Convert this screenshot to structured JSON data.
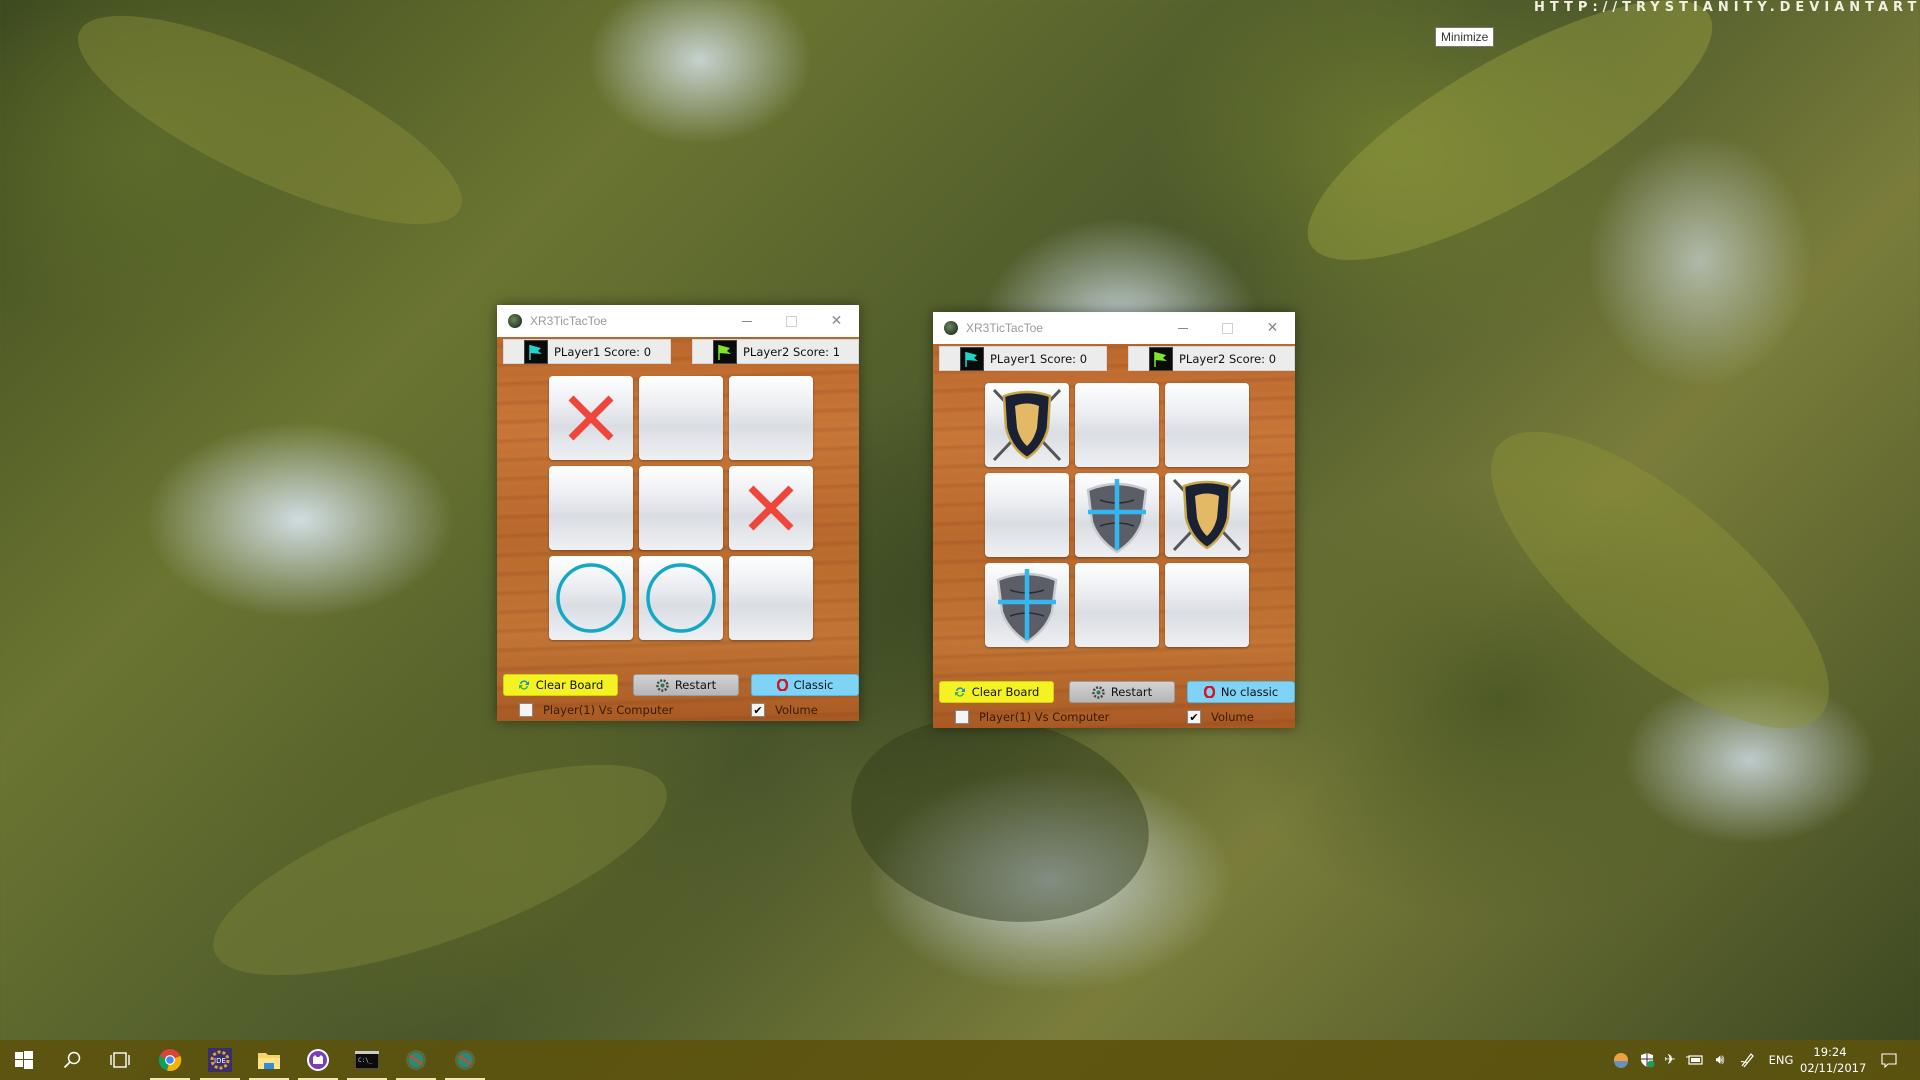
{
  "desktop": {
    "watermark": "HTTP://TRYSTIANITY.DEVIANTART.COM",
    "tooltip": "Minimize"
  },
  "windows": [
    {
      "title": "XR3TicTacToe",
      "player1": {
        "label": "PLayer1 Score: 0",
        "score": 0,
        "flag_color": "#22d3c8"
      },
      "player2": {
        "label": "PLayer2 Score: 1",
        "score": 1,
        "flag_color": "#7ee52a"
      },
      "theme": "classic",
      "board": [
        "X",
        "",
        "",
        "",
        "",
        "X",
        "O",
        "O",
        ""
      ],
      "buttons": {
        "clear": "Clear Board",
        "restart": "Restart",
        "mode": "Classic"
      },
      "vs_computer": {
        "label": "Player(1) Vs Computer",
        "checked": false
      },
      "volume": {
        "label": "Volume",
        "checked": true
      }
    },
    {
      "title": "XR3TicTacToe",
      "player1": {
        "label": "PLayer1 Score: 0",
        "score": 0,
        "flag_color": "#22d3c8"
      },
      "player2": {
        "label": "PLayer2 Score: 0",
        "score": 0,
        "flag_color": "#7ee52a"
      },
      "theme": "shields",
      "board": [
        "gold-shield",
        "",
        "",
        "",
        "blue-cross-shield",
        "gold-shield",
        "blue-cross-shield",
        "",
        ""
      ],
      "buttons": {
        "clear": "Clear Board",
        "restart": "Restart",
        "mode": "No classic"
      },
      "vs_computer": {
        "label": "Player(1) Vs Computer",
        "checked": false
      },
      "volume": {
        "label": "Volume",
        "checked": true
      }
    }
  ],
  "colors": {
    "x_mark": "#f0453a",
    "o_mark": "#14a8c4",
    "clear_button": "#f5f224",
    "mode_button": "#7fd3f7",
    "taskbar": "#5c520e"
  },
  "taskbar": {
    "apps": [
      {
        "name": "start",
        "icon": "windows-icon"
      },
      {
        "name": "search",
        "icon": "search-icon"
      },
      {
        "name": "task-view",
        "icon": "task-view-icon"
      },
      {
        "name": "chrome",
        "icon": "chrome-icon"
      },
      {
        "name": "java-ee-ide",
        "icon": "java-ee-ide-icon",
        "badge": "Java EE IDE"
      },
      {
        "name": "file-explorer",
        "icon": "folder-icon"
      },
      {
        "name": "github-desktop",
        "icon": "github-icon"
      },
      {
        "name": "command-prompt",
        "icon": "terminal-icon"
      },
      {
        "name": "xr3tictactoe-1",
        "icon": "game-icon"
      },
      {
        "name": "xr3tictactoe-2",
        "icon": "game-icon"
      }
    ],
    "tray": {
      "language": "ENG",
      "time": "19:24",
      "date": "02/11/2017"
    }
  }
}
